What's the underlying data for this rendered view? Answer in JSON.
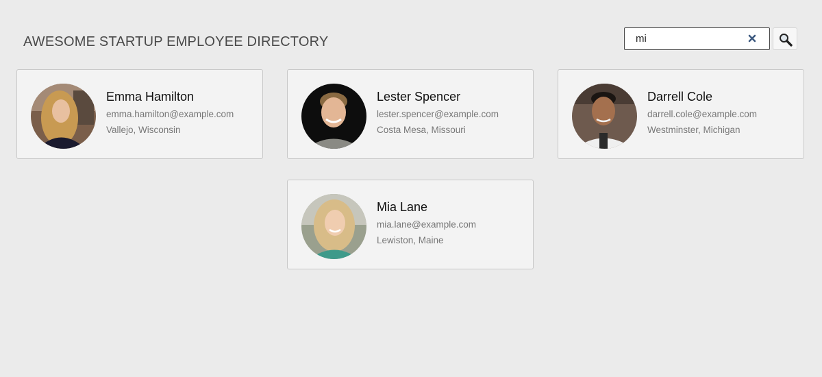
{
  "header": {
    "title": "AWESOME STARTUP EMPLOYEE DIRECTORY"
  },
  "search": {
    "value": "mi",
    "clear_icon": "close-icon",
    "button_icon": "search-icon"
  },
  "colors": {
    "page_background": "#ebebeb",
    "card_background": "#f3f3f3",
    "title_text": "#4a4a4a",
    "clear_icon": "#3d5a80"
  },
  "employees": [
    {
      "name": "Emma Hamilton",
      "email": "emma.hamilton@example.com",
      "location": "Vallejo, Wisconsin",
      "avatar": "woman-portrait"
    },
    {
      "name": "Lester Spencer",
      "email": "lester.spencer@example.com",
      "location": "Costa Mesa, Missouri",
      "avatar": "man-portrait"
    },
    {
      "name": "Darrell Cole",
      "email": "darrell.cole@example.com",
      "location": "Westminster, Michigan",
      "avatar": "man-portrait"
    },
    {
      "name": "Mia Lane",
      "email": "mia.lane@example.com",
      "location": "Lewiston, Maine",
      "avatar": "woman-portrait"
    }
  ]
}
